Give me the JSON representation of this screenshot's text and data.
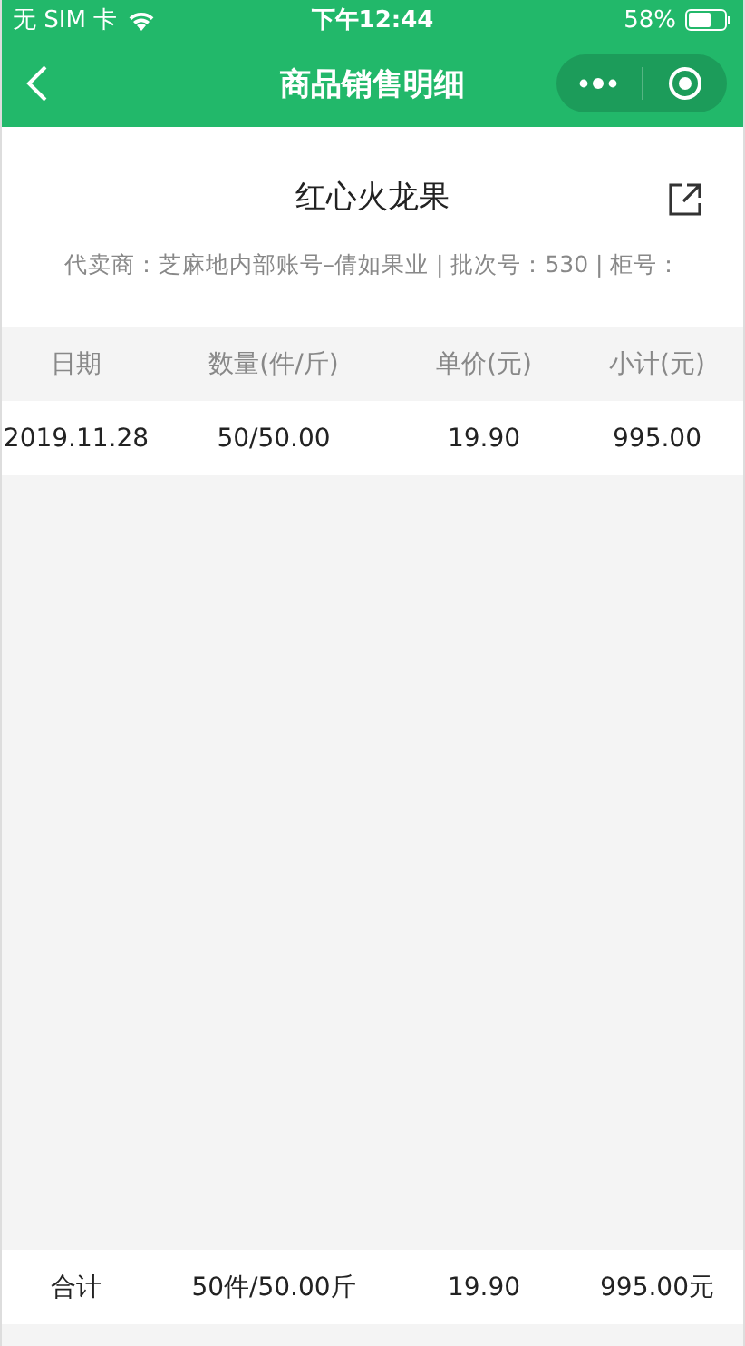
{
  "status_bar": {
    "carrier": "无 SIM 卡",
    "time": "下午12:44",
    "battery": "58%"
  },
  "nav_bar": {
    "title": "商品销售明细"
  },
  "product": {
    "name": "红心火龙果",
    "info": "代卖商：芝麻地内部账号–倩如果业 | 批次号：530 | 柜号："
  },
  "table": {
    "columns": [
      "日期",
      "数量(件/斤)",
      "单价(元)",
      "小计(元)"
    ],
    "rows": [
      [
        "2019.11.28",
        "50/50.00",
        "19.90",
        "995.00"
      ]
    ]
  },
  "totals": [
    "合计",
    "50件/50.00斤",
    "19.90",
    "995.00元"
  ]
}
